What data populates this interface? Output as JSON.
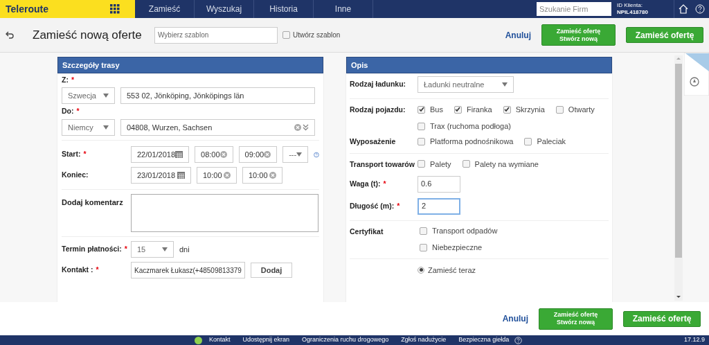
{
  "top_nav": {
    "logo": "Teleroute",
    "items": [
      {
        "label": "Zamieść",
        "selected": false
      },
      {
        "label": "Wyszukaj",
        "selected": false
      },
      {
        "label": "Historia",
        "selected": false
      },
      {
        "label": "Inne",
        "selected": false
      }
    ],
    "company_search": {
      "placeholder": "Szukanie Firm"
    },
    "client_id_label": "ID Klienta:",
    "client_id": "NPIL418780"
  },
  "toolbar": {
    "title": "Zamieść nową oferte",
    "template": {
      "placeholder": "Wybierz szablon"
    },
    "create_template": {
      "label": "Utwórz szablon",
      "checked": false
    },
    "cancel": "Anuluj",
    "post_new": [
      "Zamieść ofertę",
      "Stwórz nową"
    ],
    "post": "Zamieść ofertę"
  },
  "route": {
    "title": "Szczegóły trasy",
    "from": {
      "label": "Z:",
      "required_mark": "*",
      "country": "Szwecja",
      "place": "553 02, Jönköping, Jönköpings län"
    },
    "to": {
      "label": "Do:",
      "required_mark": "*",
      "country": "Niemcy",
      "place": "04808, Wurzen, Sachsen"
    },
    "start": {
      "label": "Start:",
      "required_mark": "*",
      "date": "22/01/2018",
      "time_from": "08:00",
      "time_to": "09:00",
      "extra": "---"
    },
    "end": {
      "label": "Koniec:",
      "date": "23/01/2018",
      "time_from": "10:00",
      "time_to": "10:00"
    },
    "comment": {
      "label": "Dodaj komentarz"
    },
    "payment": {
      "label": "Termin płatności:",
      "required_mark": "*",
      "value": "15",
      "unit": "dni"
    },
    "contact": {
      "label": "Kontakt :",
      "required_mark": "*",
      "value": "Kaczmarek Łukasz(+48509813379",
      "button": "Dodaj"
    }
  },
  "description": {
    "title": "Opis",
    "rows": [
      {
        "kind": "select",
        "label": "Rodzaj ładunku:",
        "value": "Ładunki neutralne"
      },
      {
        "kind": "divider"
      },
      {
        "kind": "checks",
        "label": "Rodzaj pojazdu:",
        "options": [
          {
            "label": "Bus",
            "checked": true
          },
          {
            "label": "Firanka",
            "checked": true
          },
          {
            "label": "Skrzynia",
            "checked": true
          },
          {
            "label": "Otwarty",
            "checked": false
          },
          {
            "label": "Trax (ruchoma podłoga)",
            "checked": false
          }
        ]
      },
      {
        "kind": "checks",
        "label": "Wyposażenie",
        "options": [
          {
            "label": "Platforma podnośnikowa",
            "checked": false
          },
          {
            "label": "Paleciak",
            "checked": false
          }
        ]
      },
      {
        "kind": "divider"
      },
      {
        "kind": "checks",
        "label": "Transport towarów",
        "options": [
          {
            "label": "Palety",
            "checked": false
          },
          {
            "label": "Palety na wymiane",
            "checked": false
          }
        ]
      },
      {
        "kind": "input",
        "label": "Waga (t):",
        "required_mark": "*",
        "value": "0.6",
        "focused": false
      },
      {
        "kind": "input",
        "label": "Długość (m):",
        "required_mark": "*",
        "value": "2",
        "focused": true
      },
      {
        "kind": "divider"
      },
      {
        "kind": "stacked_checks",
        "label": "Certyfikat",
        "options": [
          {
            "label": "Transport odpadów",
            "checked": false
          },
          {
            "label": "Niebezpieczne",
            "checked": false
          }
        ]
      },
      {
        "kind": "divider"
      },
      {
        "kind": "radio",
        "options": [
          {
            "label": "Zamieść teraz",
            "selected": true
          }
        ]
      }
    ]
  },
  "actions": {
    "cancel": "Anuluj",
    "post_new": [
      "Zamieść ofertę",
      "Stwórz nową"
    ],
    "post": "Zamieść ofertę"
  },
  "footer": {
    "links": [
      "Kontakt",
      "Udostępnij ekran",
      "Ograniczenia ruchu drogowego",
      "Zgłoś nadużycie",
      "Bezpieczna giełda"
    ],
    "version": "17.12.9"
  }
}
